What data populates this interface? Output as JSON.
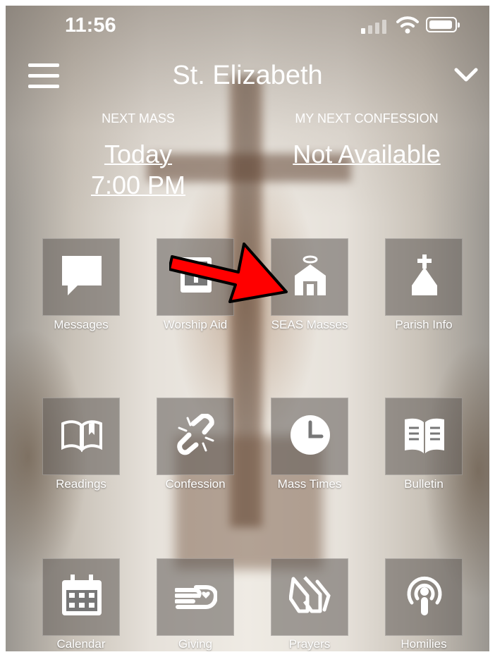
{
  "status_bar": {
    "time": "11:56"
  },
  "header": {
    "title": "St. Elizabeth"
  },
  "next_mass": {
    "label": "NEXT MASS",
    "day": "Today",
    "time": "7:00 PM"
  },
  "next_confession": {
    "label": "MY NEXT CONFESSION",
    "value": "Not Available"
  },
  "tiles": [
    {
      "label": "Messages",
      "icon": "chat-bubble-icon"
    },
    {
      "label": "Worship Aid",
      "icon": "book-icon"
    },
    {
      "label": "SEAS Masses",
      "icon": "church-halo-icon"
    },
    {
      "label": "Parish Info",
      "icon": "church-cross-icon"
    },
    {
      "label": "Readings",
      "icon": "open-book-icon"
    },
    {
      "label": "Confession",
      "icon": "broken-chain-icon"
    },
    {
      "label": "Mass Times",
      "icon": "clock-icon"
    },
    {
      "label": "Bulletin",
      "icon": "newsletter-icon"
    },
    {
      "label": "Calendar",
      "icon": "calendar-icon"
    },
    {
      "label": "Giving",
      "icon": "hand-heart-icon"
    },
    {
      "label": "Prayers",
      "icon": "praying-hands-icon"
    },
    {
      "label": "Homilies",
      "icon": "podcast-icon"
    }
  ],
  "annotation": {
    "color": "#ff0000",
    "icon": "red-arrow-icon"
  }
}
